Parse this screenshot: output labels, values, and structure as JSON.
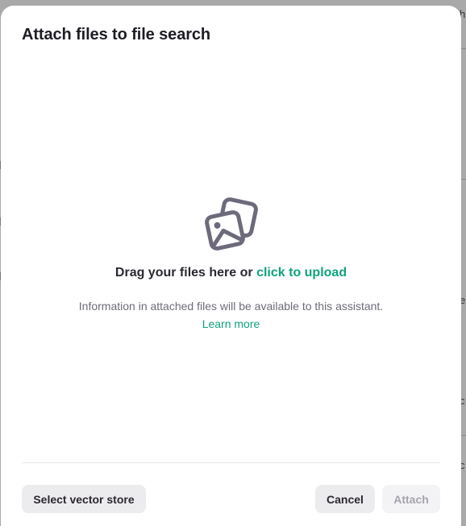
{
  "backdrop": {
    "fragments": [
      "h",
      "e",
      "c",
      "c"
    ]
  },
  "modal": {
    "title": "Attach files to file search",
    "dropzone": {
      "icon": "images-icon",
      "prompt_prefix": "Drag your files here or ",
      "upload_link": "click to upload",
      "info": "Information in attached files will be available to this assistant.",
      "learn_more": "Learn more"
    },
    "footer": {
      "select_vector_store": "Select vector store",
      "cancel": "Cancel",
      "attach": "Attach"
    }
  },
  "colors": {
    "accent": "#10a37f",
    "icon": "#6e6a7c",
    "disabled_text": "#a6a4ad"
  }
}
